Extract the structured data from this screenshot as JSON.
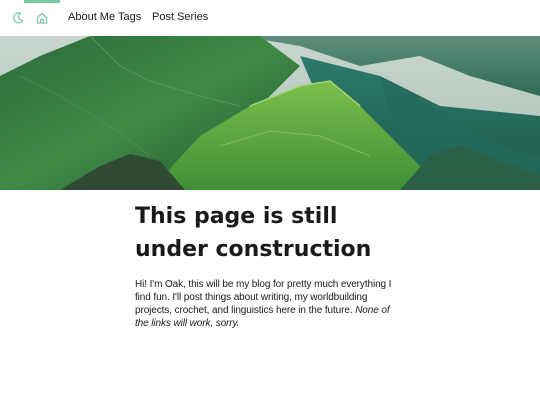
{
  "nav": {
    "theme_toggle_icon": "moon-icon",
    "home_icon": "home-icon",
    "accent_color": "#79c9a6",
    "links": [
      {
        "label": "About Me"
      },
      {
        "label": "Tags"
      },
      {
        "label": "Post Series"
      }
    ]
  },
  "hero": {
    "image": "green mountain ridges landscape banner"
  },
  "main": {
    "title": "This page is still under construction",
    "intro_text": "Hi! I'm Oak, this will be my blog for pretty much everything I find fun. I'll post things about writing, my worldbuilding projects, crochet, and linguistics here in the future.",
    "intro_italic": "None of the links will work, sorry."
  }
}
